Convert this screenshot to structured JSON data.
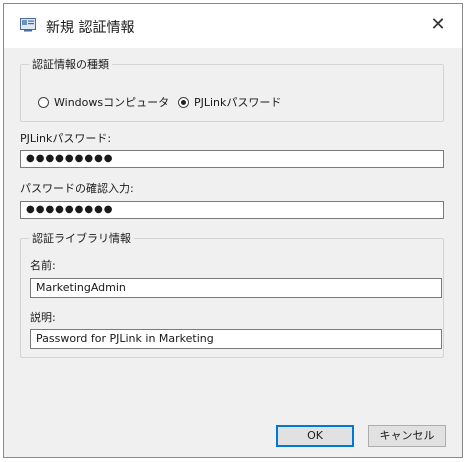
{
  "window": {
    "title": "新規 認証情報",
    "close_glyph": "✕"
  },
  "auth_type": {
    "legend": "認証情報の種類",
    "options": [
      {
        "label": "Windowsコンピュータ",
        "selected": false
      },
      {
        "label": "PJLinkパスワード",
        "selected": true
      }
    ]
  },
  "pjlink_password": {
    "label": "PJLinkパスワード:",
    "value": "●●●●●●●●●"
  },
  "password_confirm": {
    "label": "パスワードの確認入力:",
    "value": "●●●●●●●●●"
  },
  "library": {
    "legend": "認証ライブラリ情報",
    "name_label": "名前:",
    "name_value": "MarketingAdmin",
    "desc_label": "説明:",
    "desc_value": "Password for PJLink in Marketing"
  },
  "buttons": {
    "ok": "OK",
    "cancel": "キャンセル"
  },
  "colors": {
    "accent": "#0078d7",
    "dialog_bg": "#f0f0f0"
  },
  "icons": [
    "app-window-icon",
    "close-icon",
    "radio-icon"
  ]
}
